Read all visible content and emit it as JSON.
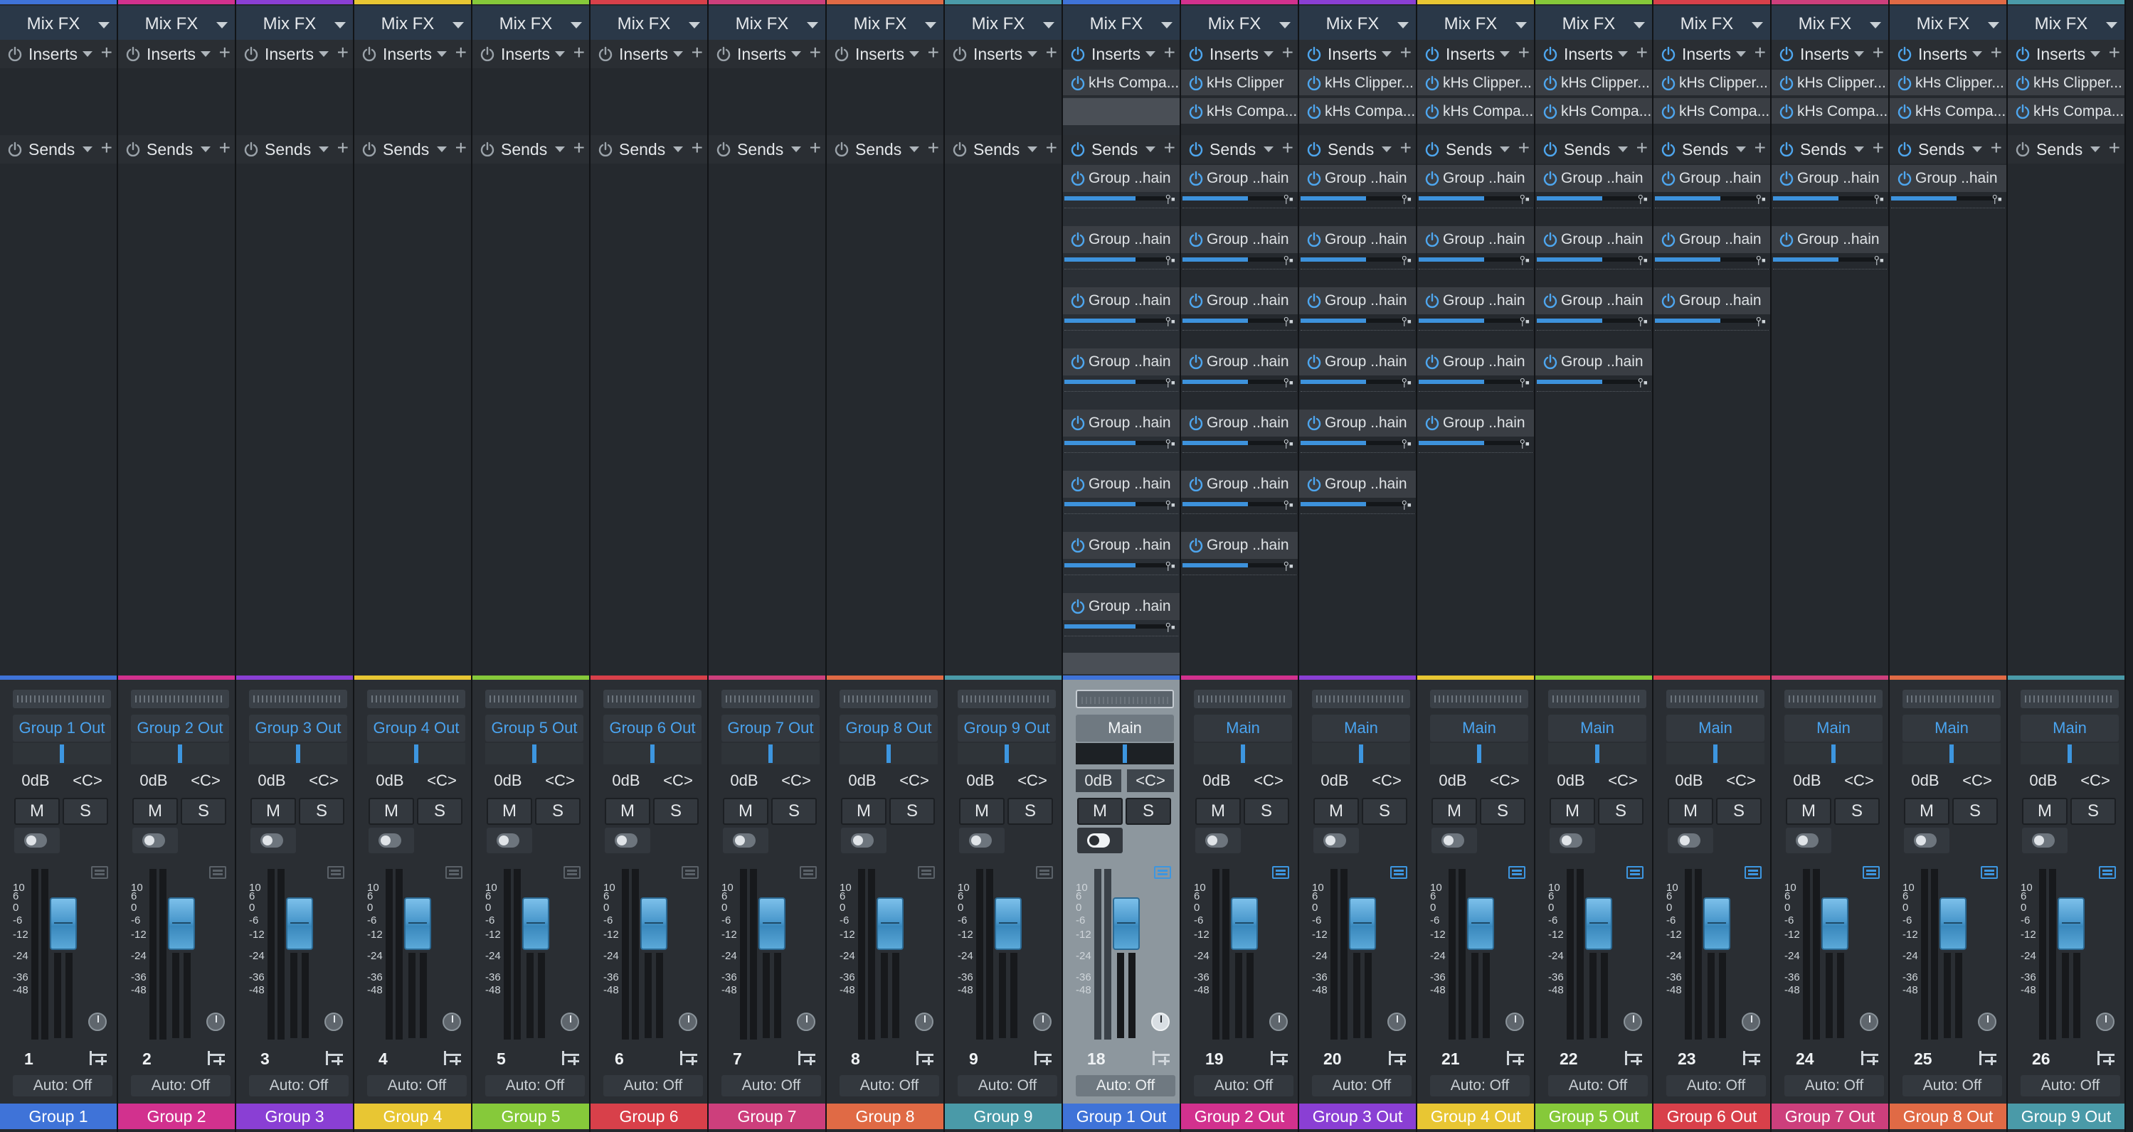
{
  "mixer": {
    "fx_label": "Mix FX",
    "inserts_label": "Inserts",
    "sends_label": "Sends",
    "auto_label": "Auto: Off",
    "mute_label": "M",
    "solo_label": "S",
    "scale_ticks": [
      "10",
      "6",
      "0",
      "-6",
      "-12",
      "-24",
      "-36",
      "-48"
    ],
    "channels": [
      {
        "number": "1",
        "name": "Group 1",
        "color": "#3f73d8",
        "output": "Group 1 Out",
        "volume": "0dB",
        "pan": "<C>",
        "inserts": [],
        "sends": [],
        "selected": false
      },
      {
        "number": "2",
        "name": "Group 2",
        "color": "#d2318e",
        "output": "Group 2 Out",
        "volume": "0dB",
        "pan": "<C>",
        "inserts": [],
        "sends": [],
        "selected": false
      },
      {
        "number": "3",
        "name": "Group 3",
        "color": "#8a3fd4",
        "output": "Group 3 Out",
        "volume": "0dB",
        "pan": "<C>",
        "inserts": [],
        "sends": [],
        "selected": false
      },
      {
        "number": "4",
        "name": "Group 4",
        "color": "#e8c633",
        "output": "Group 4 Out",
        "volume": "0dB",
        "pan": "<C>",
        "inserts": [],
        "sends": [],
        "selected": false
      },
      {
        "number": "5",
        "name": "Group 5",
        "color": "#86c93a",
        "output": "Group 5 Out",
        "volume": "0dB",
        "pan": "<C>",
        "inserts": [],
        "sends": [],
        "selected": false
      },
      {
        "number": "6",
        "name": "Group 6",
        "color": "#d8404a",
        "output": "Group 6 Out",
        "volume": "0dB",
        "pan": "<C>",
        "inserts": [],
        "sends": [],
        "selected": false
      },
      {
        "number": "7",
        "name": "Group 7",
        "color": "#cd3f7c",
        "output": "Group 7 Out",
        "volume": "0dB",
        "pan": "<C>",
        "inserts": [],
        "sends": [],
        "selected": false
      },
      {
        "number": "8",
        "name": "Group 8",
        "color": "#e06a45",
        "output": "Group 8 Out",
        "volume": "0dB",
        "pan": "<C>",
        "inserts": [],
        "sends": [],
        "selected": false
      },
      {
        "number": "9",
        "name": "Group 9",
        "color": "#4a9aa8",
        "output": "Group 9 Out",
        "volume": "0dB",
        "pan": "<C>",
        "inserts": [],
        "sends": [],
        "selected": false
      },
      {
        "number": "18",
        "name": "Group 1 Out",
        "color": "#3f73d8",
        "output": "Main",
        "volume": "0dB",
        "pan": "<C>",
        "inserts": [
          "kHs Compa..."
        ],
        "sends": [
          "Group ..hain",
          "Group ..hain",
          "Group ..hain",
          "Group ..hain",
          "Group ..hain",
          "Group ..hain",
          "Group ..hain",
          "Group ..hain"
        ],
        "selected": true
      },
      {
        "number": "19",
        "name": "Group 2 Out",
        "color": "#d2318e",
        "output": "Main",
        "volume": "0dB",
        "pan": "<C>",
        "inserts": [
          "kHs Clipper",
          "kHs Compa..."
        ],
        "sends": [
          "Group ..hain",
          "Group ..hain",
          "Group ..hain",
          "Group ..hain",
          "Group ..hain",
          "Group ..hain",
          "Group ..hain"
        ],
        "selected": false
      },
      {
        "number": "20",
        "name": "Group 3 Out",
        "color": "#8a3fd4",
        "output": "Main",
        "volume": "0dB",
        "pan": "<C>",
        "inserts": [
          "kHs Clipper...",
          "kHs Compa..."
        ],
        "sends": [
          "Group ..hain",
          "Group ..hain",
          "Group ..hain",
          "Group ..hain",
          "Group ..hain",
          "Group ..hain"
        ],
        "selected": false
      },
      {
        "number": "21",
        "name": "Group 4 Out",
        "color": "#e8c633",
        "output": "Main",
        "volume": "0dB",
        "pan": "<C>",
        "inserts": [
          "kHs Clipper...",
          "kHs Compa..."
        ],
        "sends": [
          "Group ..hain",
          "Group ..hain",
          "Group ..hain",
          "Group ..hain",
          "Group ..hain"
        ],
        "selected": false
      },
      {
        "number": "22",
        "name": "Group 5 Out",
        "color": "#86c93a",
        "output": "Main",
        "volume": "0dB",
        "pan": "<C>",
        "inserts": [
          "kHs Clipper...",
          "kHs Compa..."
        ],
        "sends": [
          "Group ..hain",
          "Group ..hain",
          "Group ..hain",
          "Group ..hain"
        ],
        "selected": false
      },
      {
        "number": "23",
        "name": "Group 6 Out",
        "color": "#d8404a",
        "output": "Main",
        "volume": "0dB",
        "pan": "<C>",
        "inserts": [
          "kHs Clipper...",
          "kHs Compa..."
        ],
        "sends": [
          "Group ..hain",
          "Group ..hain",
          "Group ..hain"
        ],
        "selected": false
      },
      {
        "number": "24",
        "name": "Group 7 Out",
        "color": "#cd3f7c",
        "output": "Main",
        "volume": "0dB",
        "pan": "<C>",
        "inserts": [
          "kHs Clipper...",
          "kHs Compa..."
        ],
        "sends": [
          "Group ..hain",
          "Group ..hain"
        ],
        "selected": false
      },
      {
        "number": "25",
        "name": "Group 8 Out",
        "color": "#e06a45",
        "output": "Main",
        "volume": "0dB",
        "pan": "<C>",
        "inserts": [
          "kHs Clipper...",
          "kHs Compa..."
        ],
        "sends": [
          "Group ..hain"
        ],
        "selected": false
      },
      {
        "number": "26",
        "name": "Group 9 Out",
        "color": "#4a9aa8",
        "output": "Main",
        "volume": "0dB",
        "pan": "<C>",
        "inserts": [
          "kHs Clipper...",
          "kHs Compa..."
        ],
        "sends": [],
        "selected": false
      }
    ]
  }
}
